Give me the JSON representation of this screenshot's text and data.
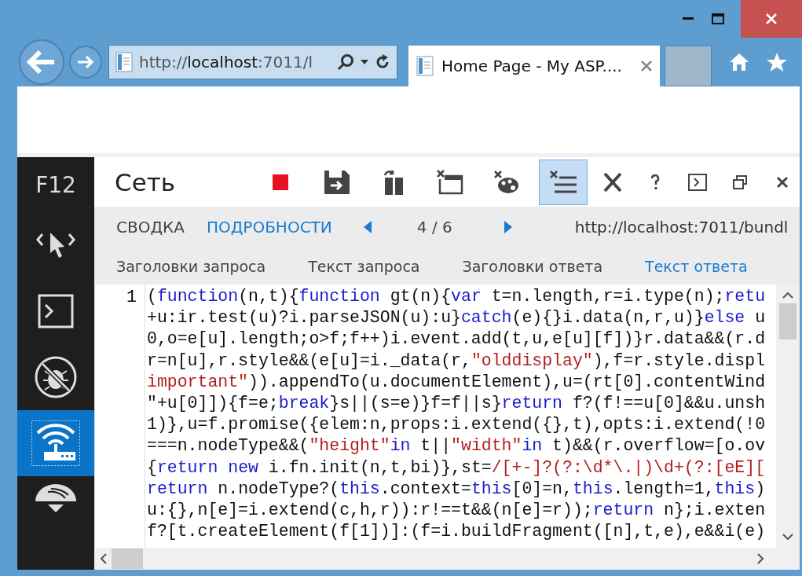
{
  "window": {
    "controls": [
      {
        "kind": "minimize"
      },
      {
        "kind": "maximize"
      },
      {
        "kind": "close"
      }
    ]
  },
  "browser": {
    "address": "http://**localhost**:7011/l",
    "tab_title": "Home Page - My ASP...."
  },
  "devtools": {
    "badge": "F12",
    "sidebar": [
      {
        "kind": "dom",
        "selected": false
      },
      {
        "kind": "console",
        "selected": false
      },
      {
        "kind": "debugger",
        "selected": false
      },
      {
        "kind": "network",
        "selected": true
      },
      {
        "kind": "performance",
        "selected": false
      }
    ],
    "title": "Сеть",
    "toolbar": [
      {
        "kind": "stop",
        "pressed": false
      },
      {
        "kind": "save",
        "pressed": false
      },
      {
        "kind": "refresh",
        "pressed": false
      },
      {
        "kind": "clear-session",
        "pressed": false
      },
      {
        "kind": "clear-cache",
        "pressed": false
      },
      {
        "kind": "clear-entries",
        "pressed": true
      },
      {
        "kind": "cut",
        "pressed": false
      },
      {
        "kind": "help",
        "pressed": false
      },
      {
        "kind": "console",
        "pressed": false
      },
      {
        "kind": "undock",
        "pressed": false
      },
      {
        "kind": "close",
        "pressed": false
      }
    ],
    "views": [
      {
        "label": "СВОДКА",
        "selected": false
      },
      {
        "label": "ПОДРОБНОСТИ",
        "selected": true
      }
    ],
    "counter": "4 / 6",
    "url": "http://localhost:7011/bundl",
    "subtabs": [
      {
        "label": "Заголовки запроса",
        "selected": false
      },
      {
        "label": "Текст запроса",
        "selected": false
      },
      {
        "label": "Заголовки ответа",
        "selected": false
      },
      {
        "label": "Текст ответа",
        "selected": true
      }
    ],
    "line_number": "1",
    "code_lines": [
      [
        {
          "kind": "plain",
          "text": "("
        },
        {
          "kind": "keyword",
          "text": "function"
        },
        {
          "kind": "plain",
          "text": "(n,t){"
        },
        {
          "kind": "keyword",
          "text": "function"
        },
        {
          "kind": "plain",
          "text": " gt(n){"
        },
        {
          "kind": "keyword",
          "text": "var"
        },
        {
          "kind": "plain",
          "text": " t=n.length,r=i.type(n);"
        },
        {
          "kind": "keyword",
          "text": "retu"
        }
      ],
      [
        {
          "kind": "plain",
          "text": "+u:ir.test(u)?i.parseJSON(u):u}"
        },
        {
          "kind": "keyword",
          "text": "catch"
        },
        {
          "kind": "plain",
          "text": "(e){}i.data(n,r,u)}"
        },
        {
          "kind": "keyword",
          "text": "else"
        },
        {
          "kind": "plain",
          "text": " u"
        }
      ],
      [
        {
          "kind": "plain",
          "text": "0,o=e[u].length;o>f;f++)i.event.add(t,u,e[u][f])}r.data&&(r.d"
        }
      ],
      [
        {
          "kind": "plain",
          "text": "r=n[u],r.style&&(e[u]=i._data(r,"
        },
        {
          "kind": "string",
          "text": "\"olddisplay\""
        },
        {
          "kind": "plain",
          "text": "),f=r.style.displ"
        }
      ],
      [
        {
          "kind": "string",
          "text": "important\""
        },
        {
          "kind": "plain",
          "text": ")).appendTo(u.documentElement),u=(rt[0].contentWind"
        }
      ],
      [
        {
          "kind": "plain",
          "text": "\"+u[0]]){f=e;"
        },
        {
          "kind": "keyword",
          "text": "break"
        },
        {
          "kind": "plain",
          "text": "}s||(s=e)}f=f||s}"
        },
        {
          "kind": "keyword",
          "text": "return"
        },
        {
          "kind": "plain",
          "text": " f?(f!==u[0]&&u.unsh"
        }
      ],
      [
        {
          "kind": "plain",
          "text": "1)},u=f.promise({elem:n,props:i.extend({},t),opts:i.extend(!0"
        }
      ],
      [
        {
          "kind": "plain",
          "text": "===n.nodeType&&("
        },
        {
          "kind": "string",
          "text": "\"height\""
        },
        {
          "kind": "keyword",
          "text": "in"
        },
        {
          "kind": "plain",
          "text": " t||"
        },
        {
          "kind": "string",
          "text": "\"width\""
        },
        {
          "kind": "keyword",
          "text": "in"
        },
        {
          "kind": "plain",
          "text": " t)&&(r.overflow=[o.ov"
        }
      ],
      [
        {
          "kind": "plain",
          "text": "{"
        },
        {
          "kind": "keyword",
          "text": "return"
        },
        {
          "kind": "keyword",
          "text": " new"
        },
        {
          "kind": "plain",
          "text": " i.fn.init(n,t,bi)},st="
        },
        {
          "kind": "string",
          "text": "/[+-]?(?:\\d*\\.|)\\d+(?:[eE]["
        }
      ],
      [
        {
          "kind": "keyword",
          "text": "return"
        },
        {
          "kind": "plain",
          "text": " n.nodeType?("
        },
        {
          "kind": "keyword",
          "text": "this"
        },
        {
          "kind": "plain",
          "text": ".context="
        },
        {
          "kind": "keyword",
          "text": "this"
        },
        {
          "kind": "plain",
          "text": "[0]=n,"
        },
        {
          "kind": "keyword",
          "text": "this"
        },
        {
          "kind": "plain",
          "text": ".length=1,"
        },
        {
          "kind": "keyword",
          "text": "this"
        },
        {
          "kind": "plain",
          "text": ")"
        }
      ],
      [
        {
          "kind": "plain",
          "text": "u:{},n[e]=i.extend(c,h,r)):r!==t&&(n[e]=r));"
        },
        {
          "kind": "keyword",
          "text": "return"
        },
        {
          "kind": "plain",
          "text": " n};i.exten"
        }
      ],
      [
        {
          "kind": "plain",
          "text": "f?[t.createElement(f[1])]:(f=i.buildFragment([n],t,e),e&&i(e)"
        }
      ]
    ]
  }
}
